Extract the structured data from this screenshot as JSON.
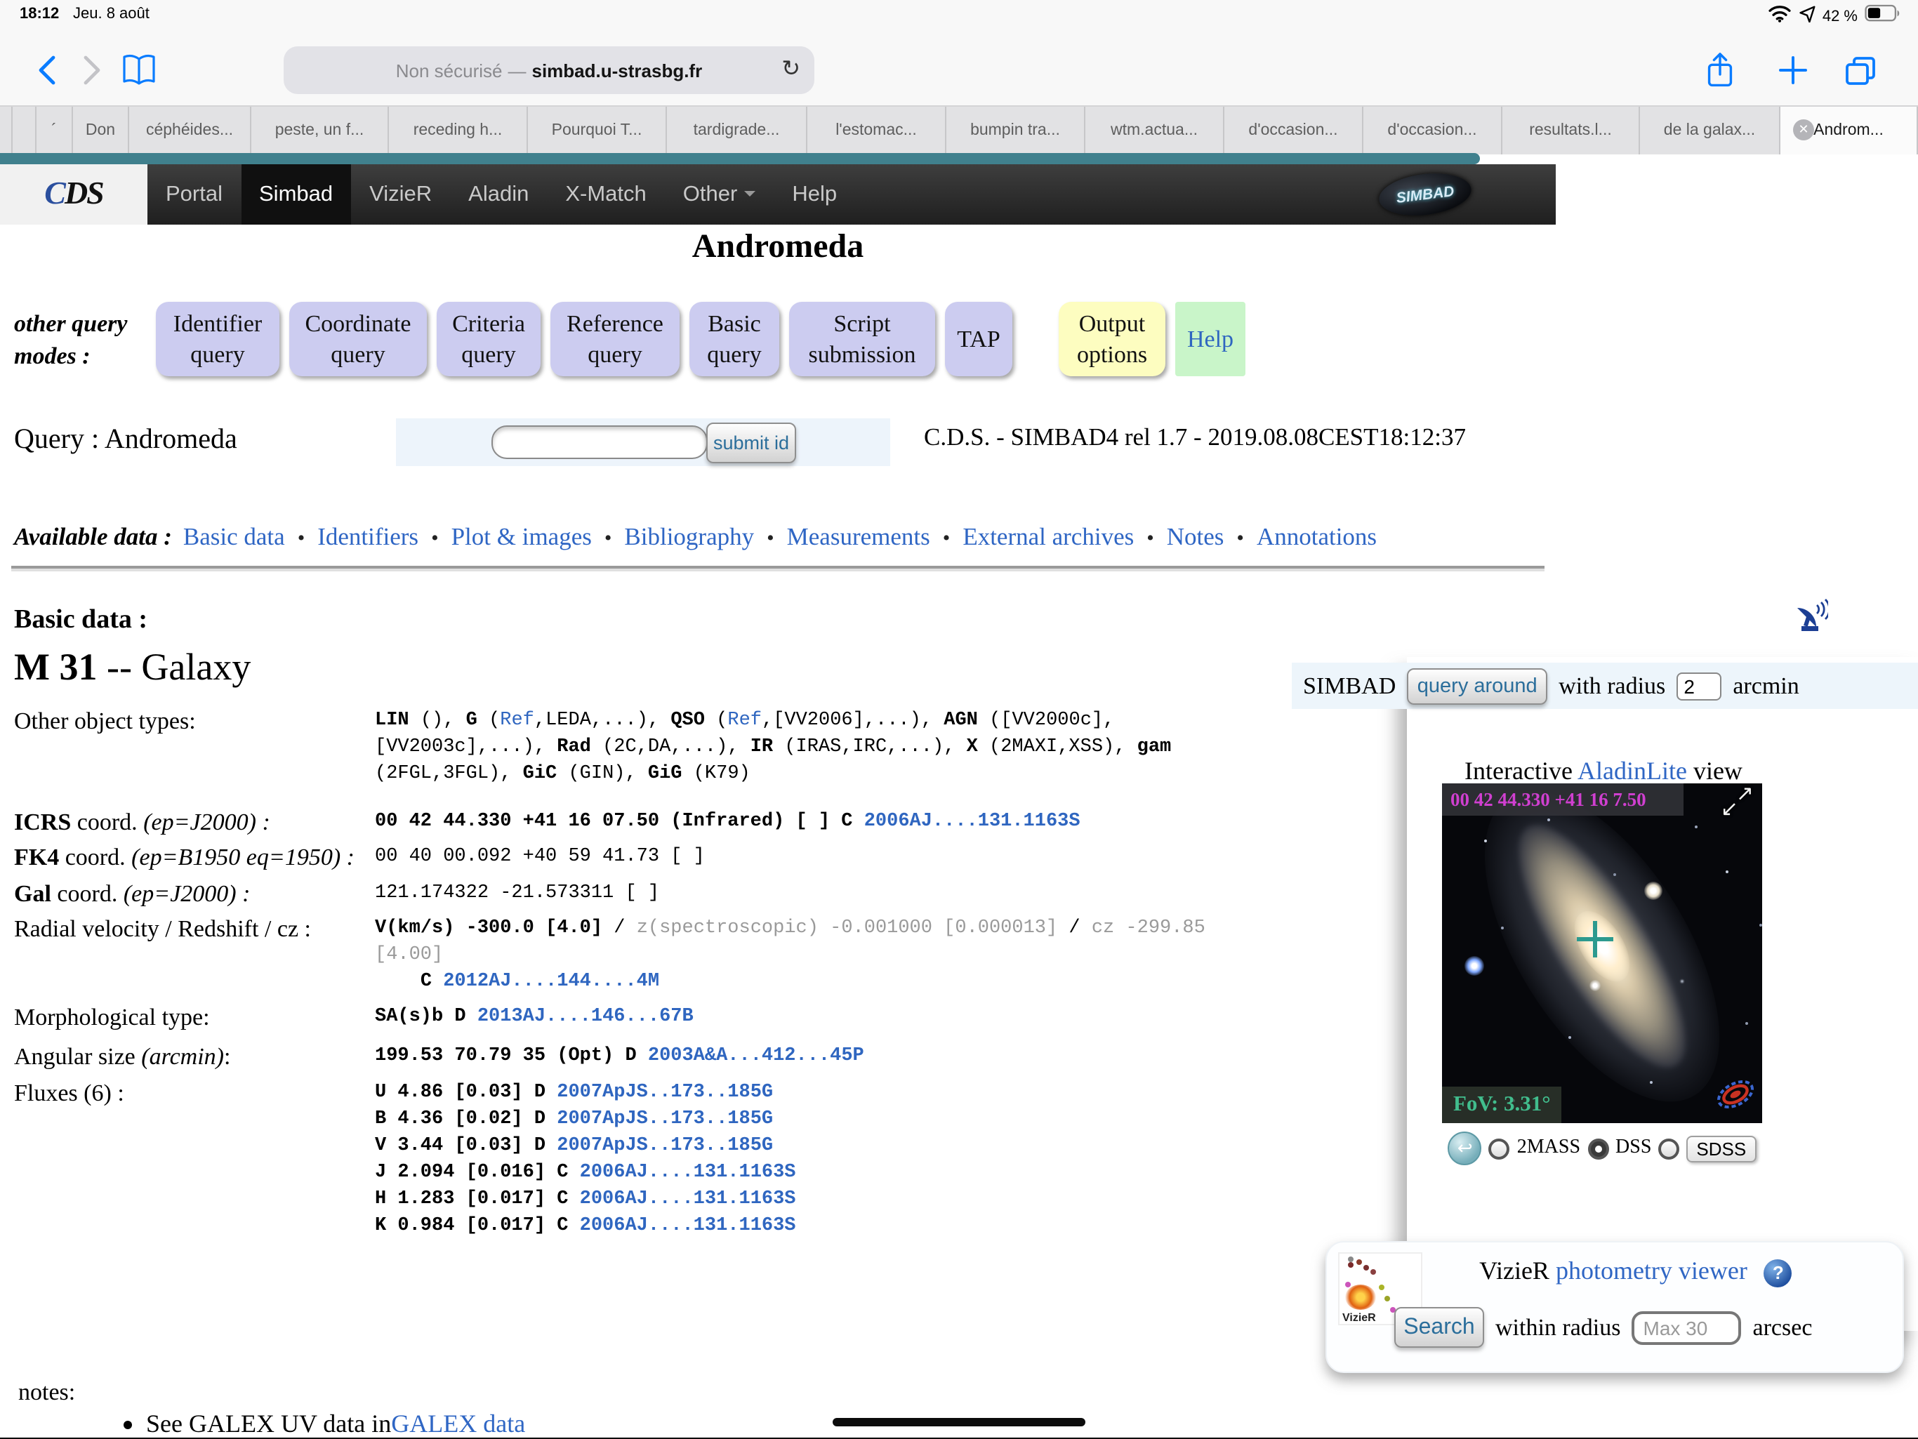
{
  "colors": {
    "accent_blue": "#007aff",
    "teal_bar": "#40808d",
    "lavender_button": "#ccccf0",
    "yellow_button": "#fdfdc0",
    "green_button": "#c9f5c9",
    "link_blue": "#2f66c4",
    "magenta_coords": "#d03fd0",
    "fov_green": "#41bd8d"
  },
  "status_bar": {
    "time": "18:12",
    "date": "Jeu. 8 août",
    "battery_level": "42 %"
  },
  "toolbar": {
    "url_security": "Non sécurisé",
    "url_separator": "—",
    "url_domain": "simbad.u-strasbg.fr",
    "reload_icon": "↻"
  },
  "tab_bar": {
    "items": [
      {
        "t": "",
        "w": 9
      },
      {
        "t": "",
        "w": 17
      },
      {
        "t": "´",
        "w": 26
      },
      {
        "t": "Don",
        "w": 40
      },
      {
        "t": "céphéides...",
        "w": 87
      },
      {
        "t": "peste, un f...",
        "w": 98
      },
      {
        "t": "receding h...",
        "w": 99
      },
      {
        "t": "Pourquoi T...",
        "w": 99
      },
      {
        "t": "tardigrade...",
        "w": 100
      },
      {
        "t": "l'estomac...",
        "w": 99
      },
      {
        "t": "bumpin tra...",
        "w": 99
      },
      {
        "t": "wtm.actua...",
        "w": 99
      },
      {
        "t": "d'occasion...",
        "w": 99
      },
      {
        "t": "d'occasion...",
        "w": 99
      },
      {
        "t": "resultats.l...",
        "w": 98
      },
      {
        "t": "de la galax...",
        "w": 100
      }
    ],
    "active": {
      "label": "Androm...",
      "close_icon": "✕"
    }
  },
  "cds_navbar": {
    "logo_c": "C",
    "logo_ds": "DS",
    "items": [
      "Portal",
      "Simbad",
      "VizieR",
      "Aladin",
      "X-Match",
      "Other",
      "Help"
    ],
    "brand": "SIMBAD"
  },
  "page": {
    "title": "Andromeda",
    "query_modes": {
      "label": "other query modes :",
      "buttons": [
        "Identifier query",
        "Coordinate query",
        "Criteria query",
        "Reference query",
        "Basic query",
        "Script submission",
        "TAP"
      ],
      "output_options": "Output options",
      "help": "Help"
    },
    "query_bar": {
      "query_label": "Query : Andromeda",
      "input_value": "",
      "submit_label": "submit id",
      "version": "C.D.S. - SIMBAD4 rel 1.7 - 2019.08.08CEST18:12:37"
    },
    "available_data": {
      "label": "Available data :",
      "items": [
        {
          "t": "Basic data",
          "s": "alink"
        },
        {
          "t": "•",
          "s": "adot"
        },
        {
          "t": "Identifiers",
          "s": "alink"
        },
        {
          "t": "•",
          "s": "adot"
        },
        {
          "t": "Plot & images",
          "s": "alink"
        },
        {
          "t": "•",
          "s": "adot"
        },
        {
          "t": "Bibliography",
          "s": "alink"
        },
        {
          "t": "•",
          "s": "adot"
        },
        {
          "t": "Measurements",
          "s": "alink"
        },
        {
          "t": "•",
          "s": "adot"
        },
        {
          "t": "External archives",
          "s": "alink"
        },
        {
          "t": "•",
          "s": "adot"
        },
        {
          "t": "Notes",
          "s": "alink"
        },
        {
          "t": "•",
          "s": "adot"
        },
        {
          "t": "Annotations",
          "s": "alink"
        }
      ]
    },
    "basic": {
      "heading": "Basic data :",
      "object_name": "M 31",
      "object_rest": " -- Galaxy",
      "rows": {
        "types": {
          "label": [
            {
              "t": "Other object types:"
            }
          ],
          "lines": [
            [
              {
                "t": "LIN",
                "s": "b"
              },
              {
                "t": " (), "
              },
              {
                "t": "G",
                "s": "b"
              },
              {
                "t": " ("
              },
              {
                "t": "Ref",
                "s": "lnk"
              },
              {
                "t": ",LEDA,...), "
              },
              {
                "t": "QSO",
                "s": "b"
              },
              {
                "t": " ("
              },
              {
                "t": "Ref",
                "s": "lnk"
              },
              {
                "t": ",[VV2006],...), "
              },
              {
                "t": "AGN",
                "s": "b"
              },
              {
                "t": " ([VV2000c],"
              }
            ],
            [
              {
                "t": "[VV2003c],...), "
              },
              {
                "t": "Rad",
                "s": "b"
              },
              {
                "t": " (2C,DA,...), "
              },
              {
                "t": "IR",
                "s": "b"
              },
              {
                "t": " (IRAS,IRC,...), "
              },
              {
                "t": "X",
                "s": "b"
              },
              {
                "t": " (2MAXI,XSS), "
              },
              {
                "t": "gam",
                "s": "b"
              }
            ],
            [
              {
                "t": "(2FGL,3FGL), "
              },
              {
                "t": "GiC",
                "s": "b"
              },
              {
                "t": " (GIN), "
              },
              {
                "t": "GiG",
                "s": "b"
              },
              {
                "t": " (K79)"
              }
            ]
          ]
        },
        "icrs": {
          "label": [
            {
              "t": "ICRS",
              "s": "b"
            },
            {
              "t": " coord. "
            },
            {
              "t": "(ep=J2000) :",
              "s": "i"
            }
          ],
          "lines": [
            [
              {
                "t": "00 42 44.330 +41 16 07.50 (Infrared) [ ] C ",
                "s": "b"
              },
              {
                "t": "2006AJ....131.1163S",
                "s": "blnk"
              }
            ]
          ]
        },
        "fk4": {
          "label": [
            {
              "t": "FK4",
              "s": "b"
            },
            {
              "t": " coord. "
            },
            {
              "t": "(ep=B1950 eq=1950) :",
              "s": "i"
            }
          ],
          "lines": [
            [
              {
                "t": "00 40 00.092 +40 59 41.73 [ ]"
              }
            ]
          ]
        },
        "gal": {
          "label": [
            {
              "t": "Gal",
              "s": "b"
            },
            {
              "t": " coord. "
            },
            {
              "t": "(ep=J2000) :",
              "s": "i"
            }
          ],
          "lines": [
            [
              {
                "t": "121.174322 -21.573311 [ ]"
              }
            ]
          ]
        },
        "velocity": {
          "label": [
            {
              "t": "Radial velocity / Redshift / cz :"
            }
          ],
          "lines": [
            [
              {
                "t": "V(km/s) -300.0 [4.0] ",
                "s": "b"
              },
              {
                "t": "/ "
              },
              {
                "t": "z(spectroscopic) -0.001000 [0.000013]",
                "s": "gry"
              },
              {
                "t": " / "
              },
              {
                "t": "cz -299.85",
                "s": "gry"
              }
            ],
            [
              {
                "t": "[4.00]",
                "s": "gry"
              }
            ],
            [
              {
                "t": "    "
              },
              {
                "t": "C ",
                "s": "b"
              },
              {
                "t": "2012AJ....144....4M",
                "s": "blnk"
              }
            ]
          ]
        },
        "morph": {
          "label": [
            {
              "t": "Morphological type:"
            }
          ],
          "lines": [
            [
              {
                "t": "SA(s)b D ",
                "s": "b"
              },
              {
                "t": "2013AJ....146...67B",
                "s": "blnk"
              }
            ]
          ]
        },
        "angsize": {
          "label": [
            {
              "t": "Angular size "
            },
            {
              "t": "(arcmin)",
              "s": "i"
            },
            {
              "t": ":"
            }
          ],
          "lines": [
            [
              {
                "t": "199.53 70.79 35 (Opt) D ",
                "s": "b"
              },
              {
                "t": "2003A&A...412...45P",
                "s": "blnk"
              }
            ]
          ]
        },
        "fluxes": {
          "label": [
            {
              "t": "Fluxes (6) :"
            }
          ],
          "lines": [
            [
              {
                "t": "U 4.86 [0.03] D ",
                "s": "b"
              },
              {
                "t": "2007ApJS..173..185G",
                "s": "blnk"
              }
            ],
            [
              {
                "t": "B 4.36 [0.02] D ",
                "s": "b"
              },
              {
                "t": "2007ApJS..173..185G",
                "s": "blnk"
              }
            ],
            [
              {
                "t": "V 3.44 [0.03] D ",
                "s": "b"
              },
              {
                "t": "2007ApJS..173..185G",
                "s": "blnk"
              }
            ],
            [
              {
                "t": "J 2.094 [0.016] C ",
                "s": "b"
              },
              {
                "t": "2006AJ....131.1163S",
                "s": "blnk"
              }
            ],
            [
              {
                "t": "H 1.283 [0.017] C ",
                "s": "b"
              },
              {
                "t": "2006AJ....131.1163S",
                "s": "blnk"
              }
            ],
            [
              {
                "t": "K 0.984 [0.017] C ",
                "s": "b"
              },
              {
                "t": "2006AJ....131.1163S",
                "s": "blnk"
              }
            ]
          ]
        }
      }
    },
    "notes": {
      "label": "notes:",
      "bullet_text": "See GALEX UV data in ",
      "bullet_link": "GALEX data"
    },
    "sidebar": {
      "query_around": {
        "prefix": "SIMBAD",
        "button": "query around",
        "middle": "with radius",
        "radius_value": "2",
        "unit": "arcmin"
      },
      "aladin": {
        "title_pre": "Interactive ",
        "title_link": "AladinLite",
        "title_post": " view",
        "coords": "00 42 44.330 +41 16 7.50",
        "fov": "FoV: 3.31°",
        "surveys": [
          {
            "label": "2MASS",
            "selected": false
          },
          {
            "label": "DSS",
            "selected": true
          },
          {
            "label": "SDSS",
            "selected": false
          }
        ]
      },
      "vizier": {
        "name": "VizieR ",
        "link": "photometry viewer",
        "help_icon": "?",
        "search_button": "Search",
        "middle": "within radius",
        "placeholder": "Max 30",
        "unit": "arcsec",
        "logo_text": "VizieR"
      }
    }
  }
}
